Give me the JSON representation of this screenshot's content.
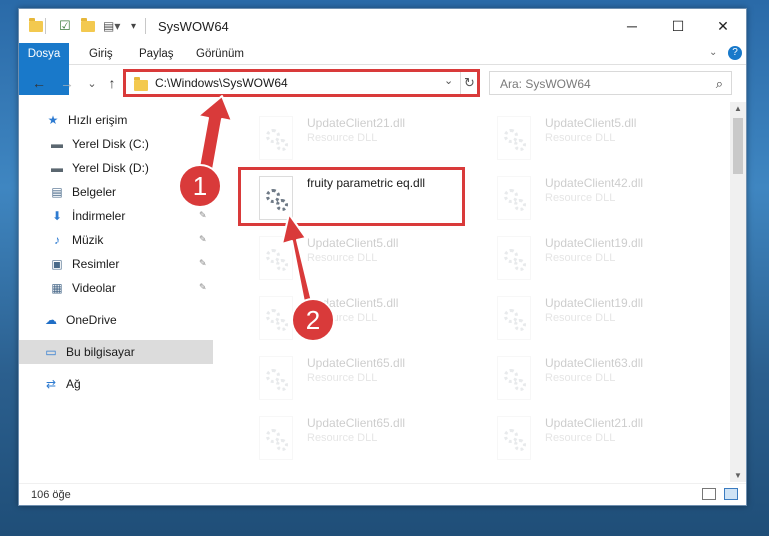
{
  "window": {
    "title": "SysWOW64",
    "controls": {
      "minimize": "─",
      "maximize": "☐",
      "close": "✕"
    }
  },
  "ribbon": {
    "tabs": [
      "Dosya",
      "Giriş",
      "Paylaş",
      "Görünüm"
    ],
    "help": "?"
  },
  "navigation": {
    "back": "←",
    "forward": "→",
    "recent": "⌄",
    "up": "↑",
    "address": "C:\\Windows\\SysWOW64",
    "refresh": "↻",
    "search_placeholder": "Ara: SysWOW64",
    "search_icon": "⌕"
  },
  "sidebar": {
    "items": [
      {
        "label": "Hızlı erişim",
        "icon": "star-icon",
        "glyph": "★",
        "color": "#2e7bd1",
        "pinned": false
      },
      {
        "label": "Yerel Disk (C:)",
        "icon": "drive-icon",
        "glyph": "▬",
        "color": "#5b6770",
        "pinned": false
      },
      {
        "label": "Yerel Disk (D:)",
        "icon": "drive-icon",
        "glyph": "▬",
        "color": "#5b6770",
        "pinned": false
      },
      {
        "label": "Belgeler",
        "icon": "document-icon",
        "glyph": "▤",
        "color": "#4a6a8a",
        "pinned": false
      },
      {
        "label": "İndirmeler",
        "icon": "download-icon",
        "glyph": "⬇",
        "color": "#2e7bd1",
        "pinned": true
      },
      {
        "label": "Müzik",
        "icon": "music-icon",
        "glyph": "♪",
        "color": "#2e7bd1",
        "pinned": true
      },
      {
        "label": "Resimler",
        "icon": "pictures-icon",
        "glyph": "▣",
        "color": "#4a6a8a",
        "pinned": true
      },
      {
        "label": "Videolar",
        "icon": "video-icon",
        "glyph": "▦",
        "color": "#4a6a8a",
        "pinned": true
      },
      {
        "label": "OneDrive",
        "icon": "cloud-icon",
        "glyph": "☁",
        "color": "#1f6ec6",
        "pinned": false
      },
      {
        "label": "Bu bilgisayar",
        "icon": "computer-icon",
        "glyph": "▭",
        "color": "#2e7bd1",
        "pinned": false
      },
      {
        "label": "Ağ",
        "icon": "network-icon",
        "glyph": "⇄",
        "color": "#2e7bd1",
        "pinned": false
      }
    ],
    "pin_glyph": "📌"
  },
  "files": [
    {
      "name": "UpdateClient21.dll",
      "type": "Resource DLL",
      "faded": true
    },
    {
      "name": "UpdateClient5.dll",
      "type": "Resource DLL",
      "faded": true
    },
    {
      "name": "fruity parametric eq.dll",
      "type": "",
      "faded": false
    },
    {
      "name": "UpdateClient42.dll",
      "type": "Resource DLL",
      "faded": true
    },
    {
      "name": "UpdateClient5.dll",
      "type": "Resource DLL",
      "faded": true
    },
    {
      "name": "UpdateClient19.dll",
      "type": "Resource DLL",
      "faded": true
    },
    {
      "name": "UpdateClient5.dll",
      "type": "Resource DLL",
      "faded": true
    },
    {
      "name": "UpdateClient19.dll",
      "type": "Resource DLL",
      "faded": true
    },
    {
      "name": "UpdateClient65.dll",
      "type": "Resource DLL",
      "faded": true
    },
    {
      "name": "UpdateClient63.dll",
      "type": "Resource DLL",
      "faded": true
    },
    {
      "name": "UpdateClient65.dll",
      "type": "Resource DLL",
      "faded": true
    },
    {
      "name": "UpdateClient21.dll",
      "type": "Resource DLL",
      "faded": true
    }
  ],
  "status": {
    "count": "106 öğe"
  },
  "callouts": {
    "one": "1",
    "two": "2"
  },
  "colors": {
    "accent": "#1979ca",
    "highlight": "#d93a3a"
  }
}
